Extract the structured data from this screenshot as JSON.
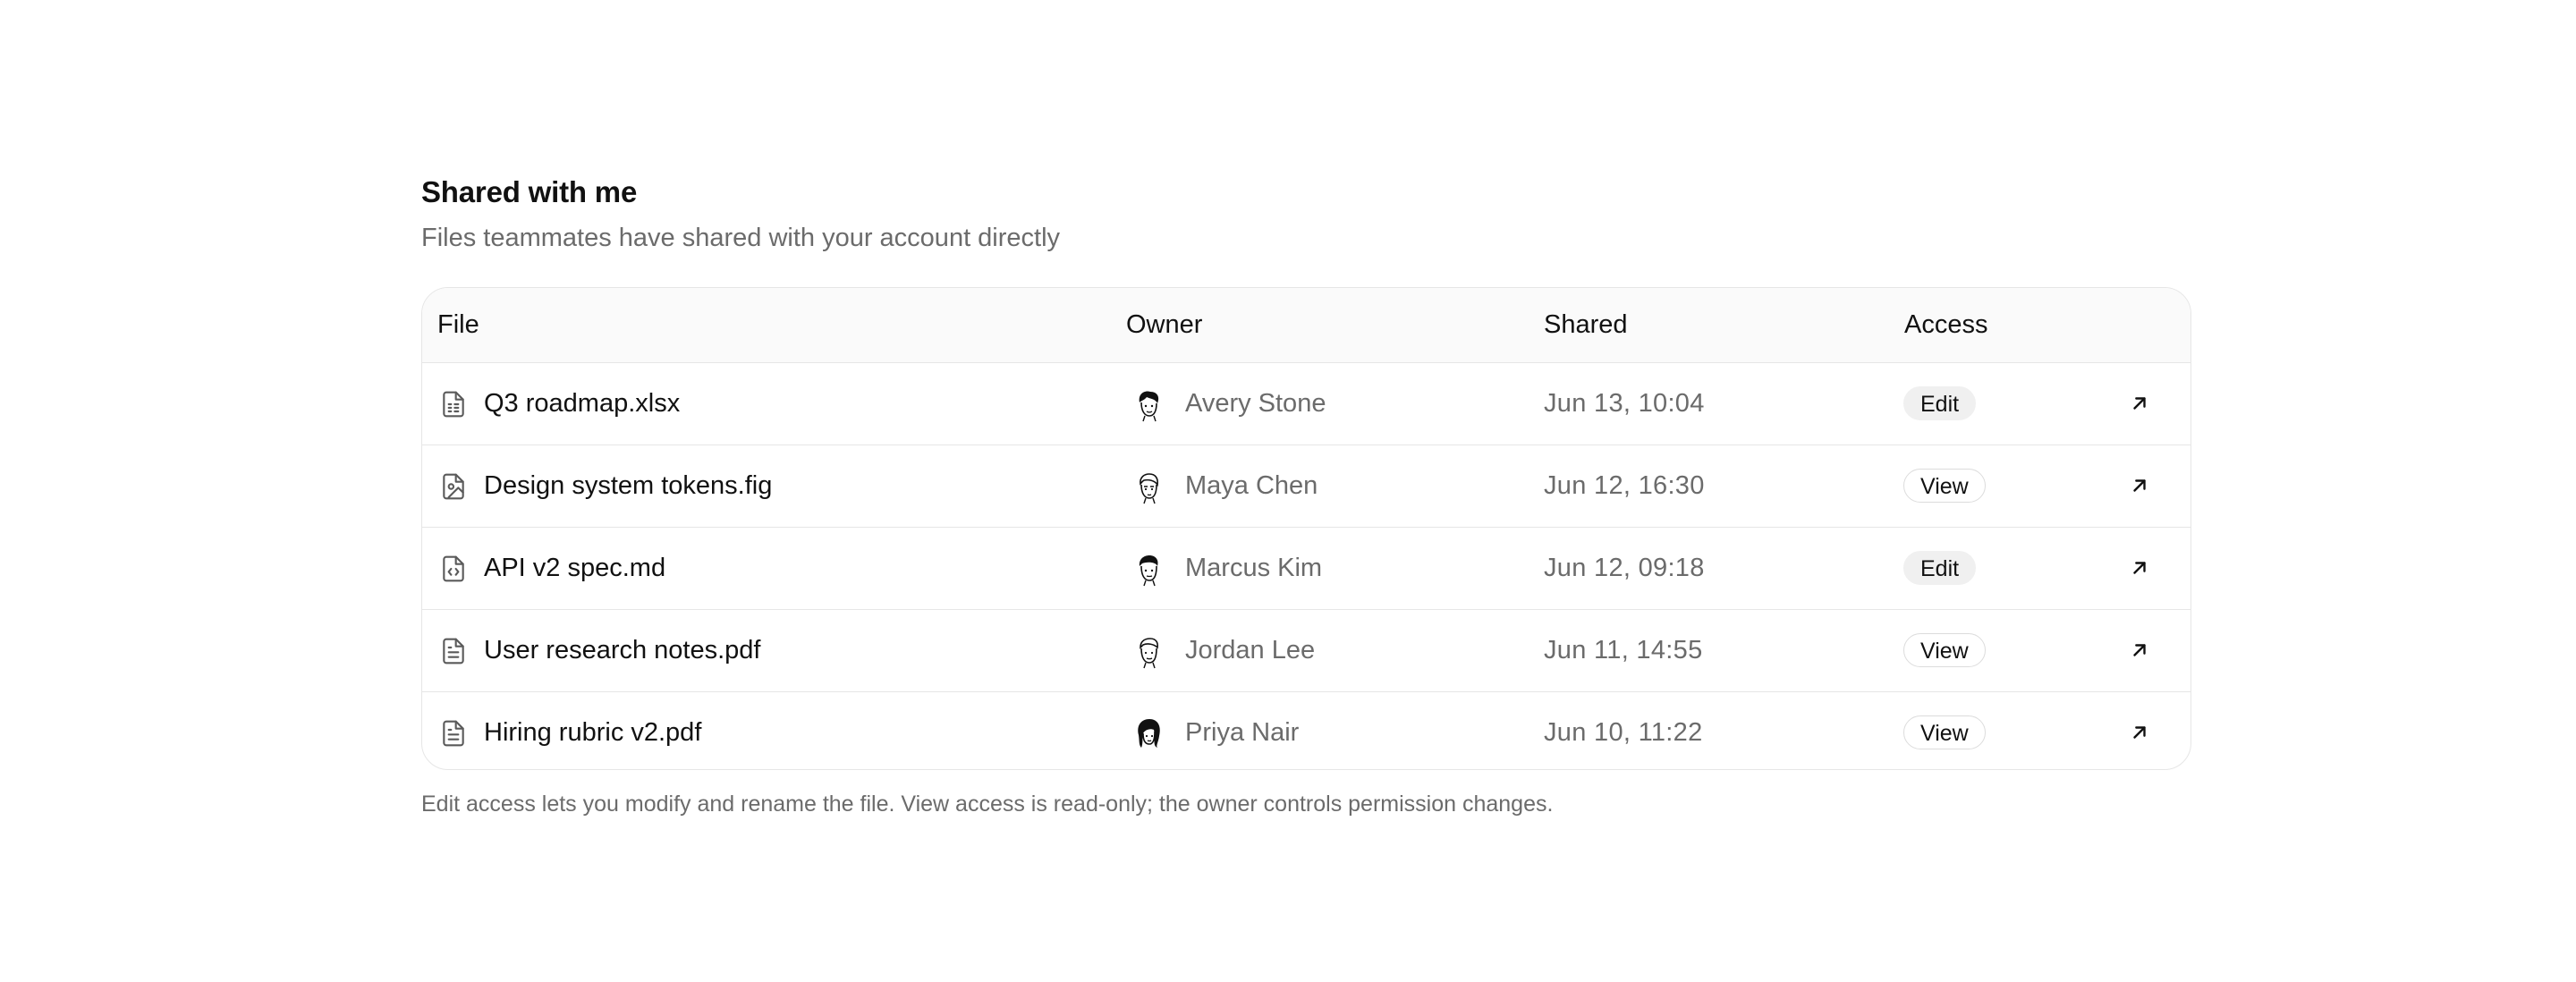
{
  "header": {
    "title": "Shared with me",
    "subtitle": "Files teammates have shared with your account directly"
  },
  "table": {
    "columns": {
      "file": "File",
      "owner": "Owner",
      "shared": "Shared",
      "access": "Access"
    },
    "rows": [
      {
        "file": "Q3 roadmap.xlsx",
        "file_icon": "spreadsheet-file-icon",
        "owner": "Avery Stone",
        "shared": "Jun 13, 10:04",
        "access": "Edit"
      },
      {
        "file": "Design system tokens.fig",
        "file_icon": "image-file-icon",
        "owner": "Maya Chen",
        "shared": "Jun 12, 16:30",
        "access": "View"
      },
      {
        "file": "API v2 spec.md",
        "file_icon": "code-file-icon",
        "owner": "Marcus Kim",
        "shared": "Jun 12, 09:18",
        "access": "Edit"
      },
      {
        "file": "User research notes.pdf",
        "file_icon": "text-file-icon",
        "owner": "Jordan Lee",
        "shared": "Jun 11, 14:55",
        "access": "View"
      },
      {
        "file": "Hiring rubric v2.pdf",
        "file_icon": "text-file-icon",
        "owner": "Priya Nair",
        "shared": "Jun 10, 11:22",
        "access": "View"
      }
    ]
  },
  "footnote": "Edit access lets you modify and rename the file. View access is read-only; the owner controls permission changes.",
  "colors": {
    "text_primary": "#111111",
    "text_secondary": "#6b6b6b",
    "border": "#e6e6e6",
    "header_bg": "#fafafa",
    "edit_badge_bg": "#f0f0f0"
  }
}
